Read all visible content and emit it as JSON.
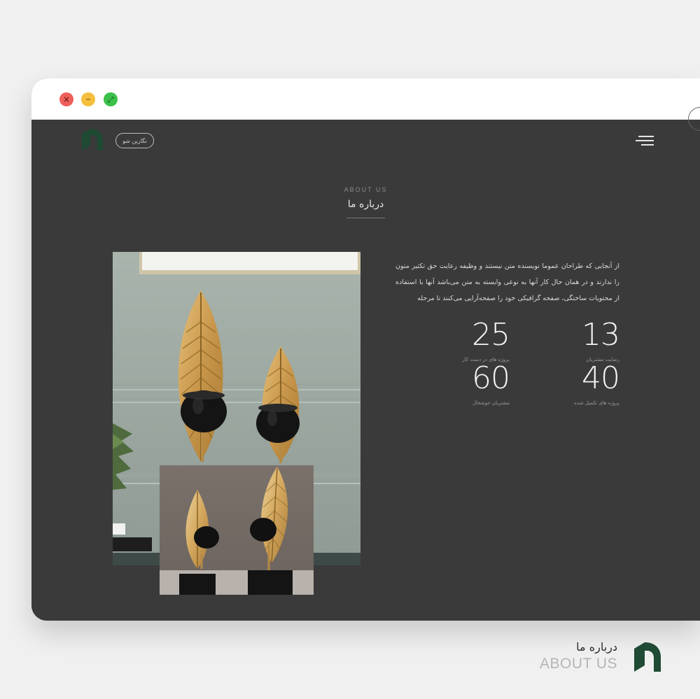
{
  "window": {
    "controls": {
      "close_glyph": "×",
      "minimize_glyph": "–",
      "maximize_glyph": "⤢"
    }
  },
  "header": {
    "logo_icon": "brand-logo-icon",
    "pill_label": "نگارین شو",
    "menu_icon": "hamburger-menu-icon"
  },
  "section": {
    "label": "ABOUT US",
    "title": "درباره ما"
  },
  "about": {
    "description": "از آنجایی که طراحان عموما نویسنده متن نیستند و وظیفه رعایت حق تکثیر متون را ندارند و در همان حال کار آنها به نوعی وابسته به متن می‌باشد آنها با استفاده از محتویات ساختگی، صفحه گرافیکی خود را صفحه‌آرایی می‌کنند تا مرحله"
  },
  "stats": [
    {
      "value": "13",
      "label": "رضایت مشتریان"
    },
    {
      "value": "25",
      "label": "پروژه های در دست کار"
    },
    {
      "value": "40",
      "label": "پروژه های تکمیل شده"
    },
    {
      "value": "60",
      "label": "مشتریان خوشحال"
    }
  ],
  "footer": {
    "title": "درباره ما",
    "subtitle": "ABOUT US",
    "logo_icon": "brand-logo-icon"
  },
  "colors": {
    "brand_green": "#1f4a33",
    "page_dark": "#3a3a3a",
    "gold": "#c79a4e"
  }
}
